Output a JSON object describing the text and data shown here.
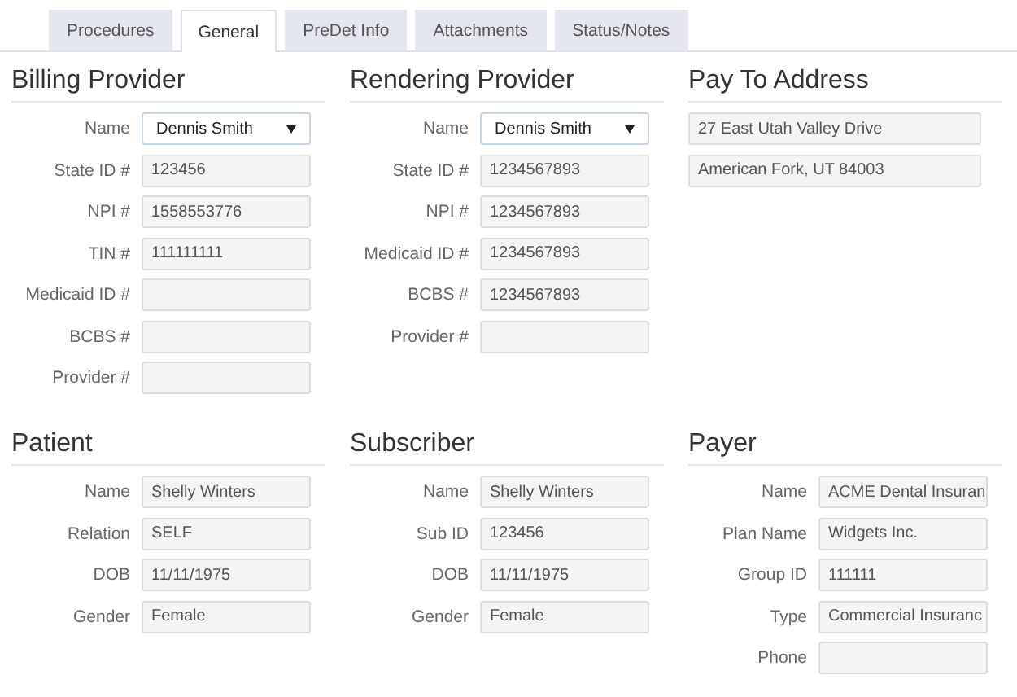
{
  "tabs": [
    {
      "label": "Procedures",
      "selected": false
    },
    {
      "label": "General",
      "selected": true
    },
    {
      "label": "PreDet Info",
      "selected": false
    },
    {
      "label": "Attachments",
      "selected": false
    },
    {
      "label": "Status/Notes",
      "selected": false
    }
  ],
  "sections": [
    {
      "title": "Billing Provider",
      "fields": [
        {
          "label": "Name",
          "kind": "select",
          "value": "Dennis Smith"
        },
        {
          "label": "State ID #",
          "kind": "text",
          "value": "123456"
        },
        {
          "label": "NPI #",
          "kind": "text",
          "value": "1558553776"
        },
        {
          "label": "TIN #",
          "kind": "text",
          "value": "111111111"
        },
        {
          "label": "Medicaid ID #",
          "kind": "text"
        },
        {
          "label": "BCBS #",
          "kind": "text"
        },
        {
          "label": "Provider #",
          "kind": "text"
        }
      ]
    },
    {
      "title": "Rendering Provider",
      "fields": [
        {
          "label": "Name",
          "kind": "select",
          "value": "Dennis Smith"
        },
        {
          "label": "State ID #",
          "kind": "text",
          "value": "1234567893"
        },
        {
          "label": "NPI #",
          "kind": "text",
          "value": "1234567893"
        },
        {
          "label": "Medicaid ID #",
          "kind": "text",
          "value": "1234567893"
        },
        {
          "label": "BCBS #",
          "kind": "text",
          "value": "1234567893"
        },
        {
          "label": "Provider #",
          "kind": "text"
        }
      ]
    },
    {
      "title": "Pay To Address",
      "fields": [
        {
          "kind": "wide",
          "value": "27 East Utah Valley Drive"
        },
        {
          "kind": "wide",
          "value": "American Fork, UT  84003"
        }
      ]
    },
    {
      "title": "Patient",
      "fields": [
        {
          "label": "Name",
          "kind": "text",
          "value": "Shelly Winters"
        },
        {
          "label": "Relation",
          "kind": "text",
          "value": "SELF"
        },
        {
          "label": "DOB",
          "kind": "text",
          "value": "11/11/1975"
        },
        {
          "label": "Gender",
          "kind": "text",
          "value": "Female"
        }
      ]
    },
    {
      "title": "Subscriber",
      "fields": [
        {
          "label": "Name",
          "kind": "text",
          "value": "Shelly Winters"
        },
        {
          "label": "Sub ID",
          "kind": "text",
          "value": "123456"
        },
        {
          "label": "DOB",
          "kind": "text",
          "value": "11/11/1975"
        },
        {
          "label": "Gender",
          "kind": "text",
          "value": "Female"
        }
      ]
    },
    {
      "title": "Payer",
      "fields": [
        {
          "label": "Name",
          "kind": "text",
          "value": "ACME Dental Insuran"
        },
        {
          "label": "Plan Name",
          "kind": "text",
          "value": "Widgets Inc."
        },
        {
          "label": "Group ID",
          "kind": "text",
          "value": "111111"
        },
        {
          "label": "Type",
          "kind": "text",
          "value": "Commercial Insuranc"
        },
        {
          "label": "Phone",
          "kind": "text"
        }
      ]
    }
  ]
}
